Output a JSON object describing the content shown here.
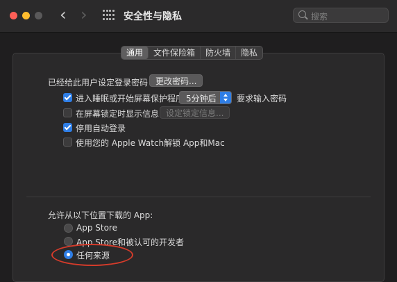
{
  "window": {
    "title": "安全性与隐私"
  },
  "search": {
    "placeholder": "搜索"
  },
  "tabs": [
    {
      "label": "通用",
      "active": true
    },
    {
      "label": "文件保险箱",
      "active": false
    },
    {
      "label": "防火墙",
      "active": false
    },
    {
      "label": "隐私",
      "active": false
    }
  ],
  "general": {
    "password_set_label": "已经给此用户设定登录密码",
    "change_password_button": "更改密码...",
    "require_password": {
      "checked": true,
      "label_before": "进入睡眠或开始屏幕保护程序",
      "select_value": "5分钟后",
      "label_after": "要求输入密码"
    },
    "show_message": {
      "checked": false,
      "label": "在屏幕锁定时显示信息",
      "button": "设定锁定信息..."
    },
    "disable_auto_login": {
      "checked": true,
      "label": "停用自动登录"
    },
    "apple_watch_unlock": {
      "checked": false,
      "label": "使用您的 Apple Watch解锁 App和Mac"
    }
  },
  "downloads": {
    "heading": "允许从以下位置下载的 App:",
    "options": [
      {
        "label": "App Store",
        "selected": false
      },
      {
        "label": "App Store和被认可的开发者",
        "selected": false
      },
      {
        "label": "任何来源",
        "selected": true
      }
    ]
  },
  "colors": {
    "accent": "#2f7ee6",
    "annotation": "#d53b2a",
    "window_bg": "#1f1e1f",
    "panel_bg": "#2a292a"
  }
}
